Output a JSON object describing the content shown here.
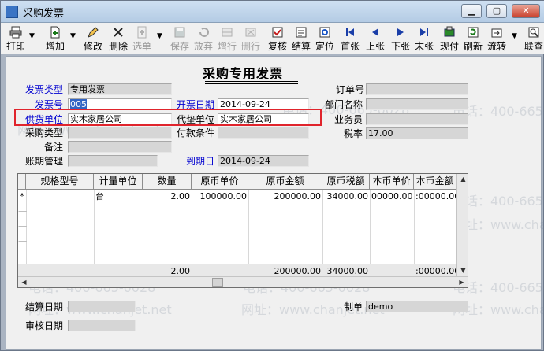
{
  "window": {
    "title": "采购发票"
  },
  "window_controls": {
    "minimize": "▁",
    "maximize": "▢",
    "close": "✕"
  },
  "toolbar": {
    "print": "打印",
    "add": "增加",
    "edit": "修改",
    "delete": "删除",
    "choose": "选单",
    "save": "保存",
    "abandon": "放弃",
    "add_row": "增行",
    "delete_row": "删行",
    "review": "复核",
    "settle": "结算",
    "locate": "定位",
    "first": "首张",
    "prev": "上张",
    "next": "下张",
    "last": "末张",
    "stock": "现付",
    "refresh": "刷新",
    "flow": "流转",
    "link": "联查"
  },
  "form": {
    "title": "采购专用发票",
    "invoice_type": {
      "label": "发票类型",
      "value": "专用发票"
    },
    "invoice_no": {
      "label": "发票号",
      "value": "005"
    },
    "supplier": {
      "label": "供货单位",
      "value": "实木家居公司"
    },
    "purchase_type": {
      "label": "采购类型",
      "value": ""
    },
    "remark": {
      "label": "备注",
      "value": ""
    },
    "account_mgmt": {
      "label": "账期管理",
      "value": ""
    },
    "invoice_date": {
      "label": "开票日期",
      "value": "2014-09-24"
    },
    "advance_unit": {
      "label": "代垫单位",
      "value": "实木家居公司"
    },
    "payment_terms": {
      "label": "付款条件",
      "value": ""
    },
    "due_date": {
      "label": "到期日",
      "value": "2014-09-24"
    },
    "order_no": {
      "label": "订单号",
      "value": ""
    },
    "dept": {
      "label": "部门名称",
      "value": ""
    },
    "clerk": {
      "label": "业务员",
      "value": ""
    },
    "tax_rate": {
      "label": "税率",
      "value": "17.00"
    },
    "settle_date": {
      "label": "结算日期",
      "value": ""
    },
    "review_date": {
      "label": "审核日期",
      "value": ""
    },
    "maker": {
      "label": "制单",
      "value": "demo"
    }
  },
  "grid": {
    "columns": [
      "规格型号",
      "计量单位",
      "数量",
      "原币单价",
      "原币金额",
      "原币税额",
      "本币单价",
      "本币金额"
    ],
    "rows": [
      {
        "marker": "*",
        "spec": "",
        "unit": "台",
        "qty": "2.00",
        "price": "100000.00",
        "amount": "200000.00",
        "tax": "34000.00",
        "local_price": "00000.00",
        "local_amount": ":00000.00"
      }
    ],
    "totals": {
      "qty": "2.00",
      "amount": "200000.00",
      "tax": "34000.00",
      "local_amount": ":00000.00"
    }
  },
  "watermark": {
    "phone": "电话：400-665-0028",
    "site": "网址：www.chanjet.net"
  },
  "colors": {
    "highlight_box": "#e0242c",
    "label_blue": "#0000d0",
    "selection": "#3164c4"
  }
}
